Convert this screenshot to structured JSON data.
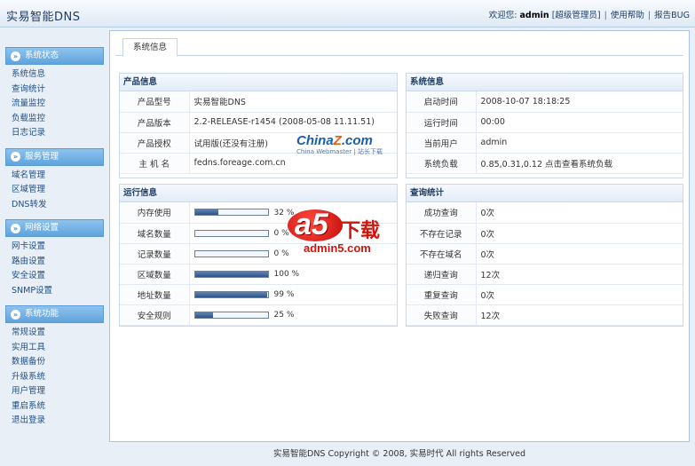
{
  "header": {
    "title": "实易智能DNS",
    "welcome": "欢迎您:",
    "username": "admin",
    "role": "[超级管理员]",
    "help": "使用帮助",
    "report_bug": "报告BUG"
  },
  "sidebar": {
    "groups": [
      {
        "title": "系统状态",
        "items": [
          "系统信息",
          "查询统计",
          "流量监控",
          "负载监控",
          "日志记录"
        ]
      },
      {
        "title": "服务管理",
        "items": [
          "域名管理",
          "区域管理",
          "DNS转发"
        ]
      },
      {
        "title": "网络设置",
        "items": [
          "网卡设置",
          "路由设置",
          "安全设置",
          "SNMP设置"
        ]
      },
      {
        "title": "系统功能",
        "items": [
          "常规设置",
          "实用工具",
          "数据备份",
          "升级系统",
          "用户管理",
          "重启系统",
          "退出登录"
        ]
      }
    ]
  },
  "main": {
    "tab": "系统信息"
  },
  "product": {
    "title": "产品信息",
    "rows": [
      {
        "label": "产品型号",
        "value": "实易智能DNS"
      },
      {
        "label": "产品版本",
        "value": "2.2-RELEASE-r1454 (2008-05-08 11.11.51)"
      },
      {
        "label": "产品授权",
        "value": "试用版(还没有注册)"
      },
      {
        "label": "主 机 名",
        "value": "fedns.foreage.com.cn"
      }
    ]
  },
  "system": {
    "title": "系统信息",
    "rows": [
      {
        "label": "启动时间",
        "value": "2008-10-07 18:18:25"
      },
      {
        "label": "运行时间",
        "value": "00:00"
      },
      {
        "label": "当前用户",
        "value": "admin"
      },
      {
        "label": "系统负载",
        "value": "0.85,0.31,0.12 点击查看系统负载"
      }
    ]
  },
  "runtime": {
    "title": "运行信息",
    "rows": [
      {
        "label": "内存使用",
        "percent": 32,
        "text": "32 %"
      },
      {
        "label": "域名数量",
        "percent": 0,
        "text": "0 %"
      },
      {
        "label": "记录数量",
        "percent": 0,
        "text": "0 %"
      },
      {
        "label": "区域数量",
        "percent": 100,
        "text": "100 %"
      },
      {
        "label": "地址数量",
        "percent": 99,
        "text": "99 %"
      },
      {
        "label": "安全规则",
        "percent": 25,
        "text": "25 %"
      }
    ]
  },
  "query": {
    "title": "查询统计",
    "rows": [
      {
        "label": "成功查询",
        "value": "0次"
      },
      {
        "label": "不存在记录",
        "value": "0次"
      },
      {
        "label": "不存在域名",
        "value": "0次"
      },
      {
        "label": "递归查询",
        "value": "12次"
      },
      {
        "label": "重复查询",
        "value": "0次"
      },
      {
        "label": "失败查询",
        "value": "12次"
      }
    ]
  },
  "footer": "实易智能DNS Copyright © 2008, 实易时代 All rights Reserved",
  "watermarks": {
    "china_main": "China",
    "china_z": "Z",
    "china_com": ".com",
    "china_sub": "China Webmaster | 站长下载",
    "a5": "a5",
    "a5_cn": "下载",
    "a5_site": "admin5.com"
  }
}
